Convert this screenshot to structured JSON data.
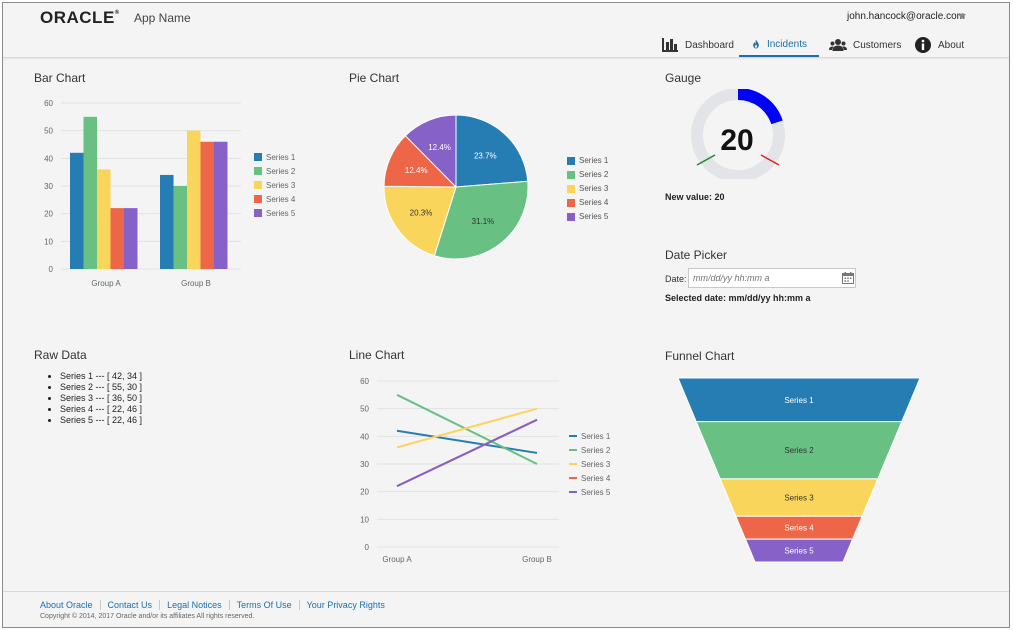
{
  "header": {
    "logo": "ORACLE",
    "app_name": "App Name",
    "user": "john.hancock@oracle.com"
  },
  "nav": [
    {
      "label": "Dashboard",
      "icon": "bar-chart-icon",
      "active": false
    },
    {
      "label": "Incidents",
      "icon": "fire-icon",
      "active": true
    },
    {
      "label": "Customers",
      "icon": "people-icon",
      "active": false
    },
    {
      "label": "About",
      "icon": "info-icon",
      "active": false
    }
  ],
  "colors": {
    "series1": "#267db3",
    "series2": "#68c182",
    "series3": "#fad55c",
    "series4": "#ed6647",
    "series5": "#8561c8",
    "accent": "#1c6fae"
  },
  "panels": {
    "bar_title": "Bar Chart",
    "pie_title": "Pie Chart",
    "gauge_title": "Gauge",
    "date_title": "Date Picker",
    "raw_title": "Raw Data",
    "line_title": "Line Chart",
    "funnel_title": "Funnel Chart"
  },
  "gauge": {
    "value": 20,
    "max": 100,
    "new_value_label": "New value: 20"
  },
  "date_picker": {
    "label": "Date:",
    "placeholder": "mm/dd/yy hh:mm a",
    "selected_label": "Selected date: mm/dd/yy hh:mm a"
  },
  "raw_data": [
    "Series 1 --- [ 42, 34 ]",
    "Series 2 --- [ 55, 30 ]",
    "Series 3 --- [ 36, 50 ]",
    "Series 4 --- [ 22, 46 ]",
    "Series 5 --- [ 22, 46 ]"
  ],
  "footer": {
    "links": [
      "About Oracle",
      "Contact Us",
      "Legal Notices",
      "Terms Of Use",
      "Your Privacy Rights"
    ],
    "copyright": "Copyright © 2014, 2017 Oracle and/or its affiliates All rights reserved."
  },
  "chart_data": [
    {
      "type": "bar",
      "title": "Bar Chart",
      "categories": [
        "Group A",
        "Group B"
      ],
      "ylim": [
        0,
        60
      ],
      "yticks": [
        0,
        10,
        20,
        30,
        40,
        50,
        60
      ],
      "legend": "right",
      "series": [
        {
          "name": "Series 1",
          "values": [
            42,
            34
          ]
        },
        {
          "name": "Series 2",
          "values": [
            55,
            30
          ]
        },
        {
          "name": "Series 3",
          "values": [
            36,
            50
          ]
        },
        {
          "name": "Series 4",
          "values": [
            22,
            46
          ]
        },
        {
          "name": "Series 5",
          "values": [
            22,
            46
          ]
        }
      ]
    },
    {
      "type": "pie",
      "title": "Pie Chart",
      "legend": "right",
      "slices": [
        {
          "name": "Series 1",
          "value": 23.7,
          "label": "23.7%"
        },
        {
          "name": "Series 2",
          "value": 31.1,
          "label": "31.1%"
        },
        {
          "name": "Series 3",
          "value": 20.3,
          "label": "20.3%"
        },
        {
          "name": "Series 4",
          "value": 12.4,
          "label": "12.4%"
        },
        {
          "name": "Series 5",
          "value": 12.4,
          "label": "12.4%"
        }
      ]
    },
    {
      "type": "line",
      "title": "Line Chart",
      "categories": [
        "Group A",
        "Group B"
      ],
      "ylim": [
        0,
        60
      ],
      "yticks": [
        0,
        10,
        20,
        30,
        40,
        50,
        60
      ],
      "legend": "right",
      "series": [
        {
          "name": "Series 1",
          "values": [
            42,
            34
          ]
        },
        {
          "name": "Series 2",
          "values": [
            55,
            30
          ]
        },
        {
          "name": "Series 3",
          "values": [
            36,
            50
          ]
        },
        {
          "name": "Series 4",
          "values": [
            22,
            46
          ]
        },
        {
          "name": "Series 5",
          "values": [
            22,
            46
          ]
        }
      ]
    },
    {
      "type": "funnel",
      "title": "Funnel Chart",
      "series": [
        {
          "name": "Series 1",
          "value": 42
        },
        {
          "name": "Series 2",
          "value": 55
        },
        {
          "name": "Series 3",
          "value": 36
        },
        {
          "name": "Series 4",
          "value": 22
        },
        {
          "name": "Series 5",
          "value": 22
        }
      ]
    }
  ]
}
